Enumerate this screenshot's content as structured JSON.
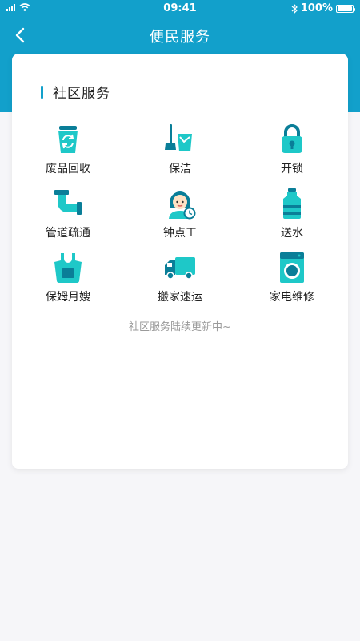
{
  "status_bar": {
    "time": "09:41",
    "battery": "100%"
  },
  "nav": {
    "title": "便民服务"
  },
  "section": {
    "title": "社区服务"
  },
  "services": [
    {
      "label": "废品回收",
      "icon": "recycle-bin-icon"
    },
    {
      "label": "保洁",
      "icon": "cleaning-tools-icon"
    },
    {
      "label": "开锁",
      "icon": "padlock-icon"
    },
    {
      "label": "管道疏通",
      "icon": "pipe-icon"
    },
    {
      "label": "钟点工",
      "icon": "housekeeper-clock-icon"
    },
    {
      "label": "送水",
      "icon": "water-bottle-icon"
    },
    {
      "label": "保姆月嫂",
      "icon": "apron-icon"
    },
    {
      "label": "搬家速运",
      "icon": "moving-truck-icon"
    },
    {
      "label": "家电维修",
      "icon": "washing-machine-icon"
    }
  ],
  "footer_note": "社区服务陆续更新中~",
  "colors": {
    "accent": "#12a0cb",
    "icon_cyan": "#1ec8c8",
    "icon_dark": "#0a7e98"
  }
}
